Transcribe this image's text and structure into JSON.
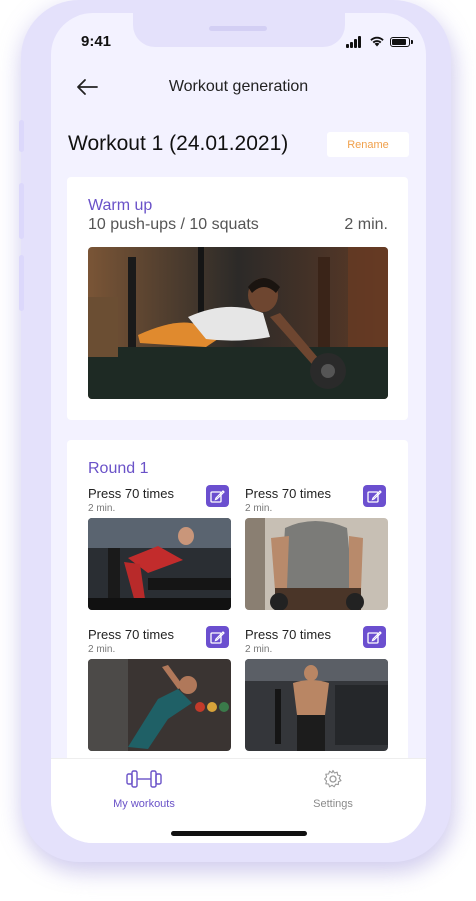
{
  "status_bar": {
    "time": "9:41"
  },
  "header": {
    "title": "Workout generation"
  },
  "workout": {
    "title": "Workout  1 (24.01.2021)",
    "rename_label": "Rename"
  },
  "warm_up": {
    "label": "Warm up",
    "description": "10 push-ups / 10 squats",
    "duration": "2 min."
  },
  "round": {
    "label": "Round 1",
    "exercises": [
      {
        "name": "Press 70 times",
        "duration": "2 min."
      },
      {
        "name": "Press 70 times",
        "duration": "2 min."
      },
      {
        "name": "Press 70 times",
        "duration": "2 min."
      },
      {
        "name": "Press 70 times",
        "duration": "2 min."
      }
    ]
  },
  "tabbar": {
    "tabs": [
      {
        "label": "My workouts",
        "icon": "dumbbell-icon",
        "active": true
      },
      {
        "label": "Settings",
        "icon": "gear-icon",
        "active": false
      }
    ]
  },
  "colors": {
    "accent": "#6b4fcf",
    "rename": "#f0a04b",
    "background": "#f3f2ff"
  }
}
